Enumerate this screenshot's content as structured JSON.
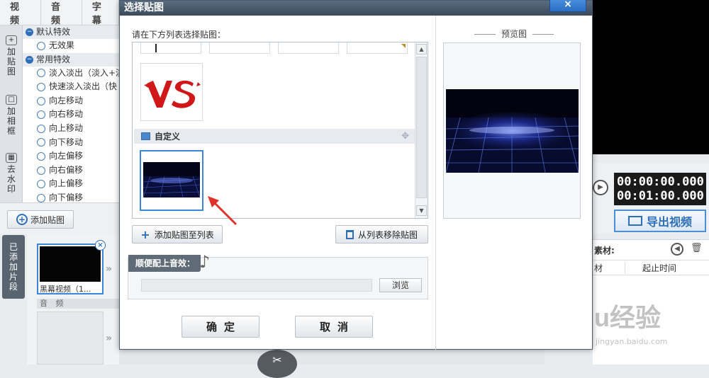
{
  "app": {
    "top_tabs": [
      "视 频",
      "音 频",
      "字幕"
    ],
    "side_tools": [
      {
        "label": "加贴图",
        "icon": "add-sticker-icon"
      },
      {
        "label": "加相框",
        "icon": "add-frame-icon"
      },
      {
        "label": "去水印",
        "icon": "remove-watermark-icon"
      }
    ],
    "effects": {
      "group1": "默认特效",
      "group1_items": [
        "无效果"
      ],
      "group2": "常用特效",
      "group2_items": [
        "淡入淡出（淡入+淡",
        "快速淡入淡出（快",
        "向左移动",
        "向右移动",
        "向上移动",
        "向下移动",
        "向左偏移",
        "向右偏移",
        "向上偏移",
        "向下偏移"
      ]
    },
    "add_sticker_button": "添加贴图",
    "clips_label": "已添加片段",
    "clip_name": "黑幕视频（1...",
    "audio_label": "音 频",
    "time_current": "00:00:00.000",
    "time_total": "00:01:00.000",
    "export_button": "导出视频",
    "material_header": "素材:",
    "material_col1": "材",
    "material_col2": "起止时间",
    "watermark_text": "Baidu经验",
    "watermark_url": "jingyan.baidu.com"
  },
  "dialog": {
    "title": "选择贴图",
    "close_icon": "×",
    "list_prompt": "请在下方列表选择贴图：",
    "custom_section": "自定义",
    "add_to_list": "添加贴图至列表",
    "remove_from_list": "从列表移除贴图",
    "sound_label": "顺便配上音效：",
    "sound_path_value": "",
    "browse": "浏览",
    "ok": "确定",
    "cancel": "取消",
    "preview_title": "预览图"
  },
  "colors": {
    "accent": "#2e6fb8",
    "selection_border": "#3a86d8",
    "arrow_red": "#e0312b",
    "vs_red": "#d01818"
  }
}
